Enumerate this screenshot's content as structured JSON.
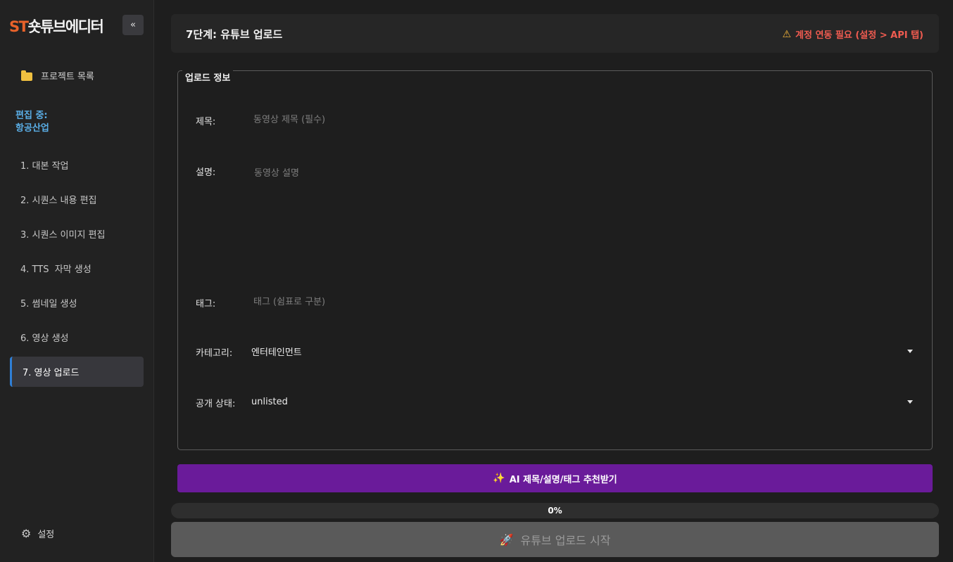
{
  "sidebar": {
    "logo_st": "ST",
    "logo_text": "숏튜브에디터",
    "collapse_label": "«",
    "project_list_label": "프로젝트 목록",
    "editing_label": "편집 중:",
    "editing_project": "항공산업",
    "steps": [
      {
        "label": "1. 대본 작업"
      },
      {
        "label": "2. 시퀀스 내용 편집"
      },
      {
        "label": "3. 시퀀스 이미지 편집"
      },
      {
        "label": "4. TTS  자막 생성"
      },
      {
        "label": "5. 썸네일 생성"
      },
      {
        "label": "6. 영상 생성"
      },
      {
        "label": "7. 영상 업로드"
      }
    ],
    "settings_label": "설정"
  },
  "header": {
    "title": "7단계: 유튜브 업로드",
    "warning": "계정 연동 필요 (설정 > API 탭)",
    "warning_color": "#ef5b50"
  },
  "upload_info": {
    "group_title": "업로드 정보",
    "title_label": "제목:",
    "title_value": "",
    "title_placeholder": "동영상 제목 (필수)",
    "description_label": "설명:",
    "description_value": "",
    "description_placeholder": "동영상 설명",
    "tags_label": "태그:",
    "tags_value": "",
    "tags_placeholder": "태그 (쉼표로 구분)",
    "category_label": "카테고리:",
    "category_value": "엔터테인먼트",
    "privacy_label": "공개 상태:",
    "privacy_value": "unlisted"
  },
  "actions": {
    "ai_button_label": "AI 제목/설명/태그 추천받기",
    "ai_button_color": "#6a1b9a",
    "progress_text": "0%",
    "progress_value": 0,
    "upload_button_label": "유튜브 업로드 시작"
  }
}
